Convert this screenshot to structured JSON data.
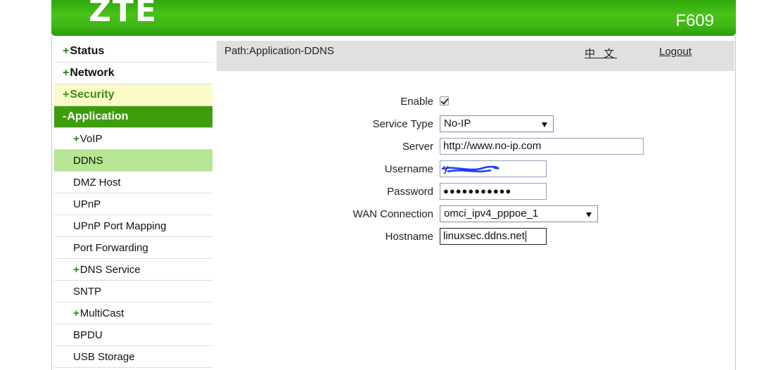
{
  "header": {
    "logo": "ZTE",
    "model": "F609"
  },
  "sidebar": {
    "items": [
      {
        "label": "Status",
        "prefix": "+",
        "level": "top"
      },
      {
        "label": "Network",
        "prefix": "+",
        "level": "top"
      },
      {
        "label": "Security",
        "prefix": "+",
        "level": "top"
      },
      {
        "label": "Application",
        "prefix": "-",
        "level": "top"
      },
      {
        "label": "VoIP",
        "prefix": "+",
        "level": "sub"
      },
      {
        "label": "DDNS",
        "prefix": "",
        "level": "sub",
        "active": true
      },
      {
        "label": "DMZ Host",
        "prefix": "",
        "level": "sub"
      },
      {
        "label": "UPnP",
        "prefix": "",
        "level": "sub"
      },
      {
        "label": "UPnP Port Mapping",
        "prefix": "",
        "level": "sub"
      },
      {
        "label": "Port Forwarding",
        "prefix": "",
        "level": "sub"
      },
      {
        "label": "DNS Service",
        "prefix": "+",
        "level": "sub"
      },
      {
        "label": "SNTP",
        "prefix": "",
        "level": "sub"
      },
      {
        "label": "MultiCast",
        "prefix": "+",
        "level": "sub"
      },
      {
        "label": "BPDU",
        "prefix": "",
        "level": "sub"
      },
      {
        "label": "USB Storage",
        "prefix": "",
        "level": "sub"
      }
    ]
  },
  "pathbar": {
    "path": "Path:Application-DDNS",
    "language_link": "中 文",
    "logout_link": "Logout"
  },
  "form": {
    "enable_label": "Enable",
    "enable_checked": true,
    "service_type_label": "Service Type",
    "service_type_value": "No-IP",
    "server_label": "Server",
    "server_value": "http://www.no-ip.com",
    "username_label": "Username",
    "username_value": "y",
    "password_label": "Password",
    "password_value": "●●●●●●●●●●●",
    "wan_connection_label": "WAN Connection",
    "wan_connection_value": "omci_ipv4_pppoe_1",
    "hostname_label": "Hostname",
    "hostname_value": "linuxsec.ddns.net"
  },
  "colors": {
    "header_green": "#3fb515",
    "menu_active_green": "#3e9c0d",
    "submenu_active": "#b6e694",
    "security_bg": "#fbfbc9",
    "redaction_blue": "#1a3cff"
  }
}
